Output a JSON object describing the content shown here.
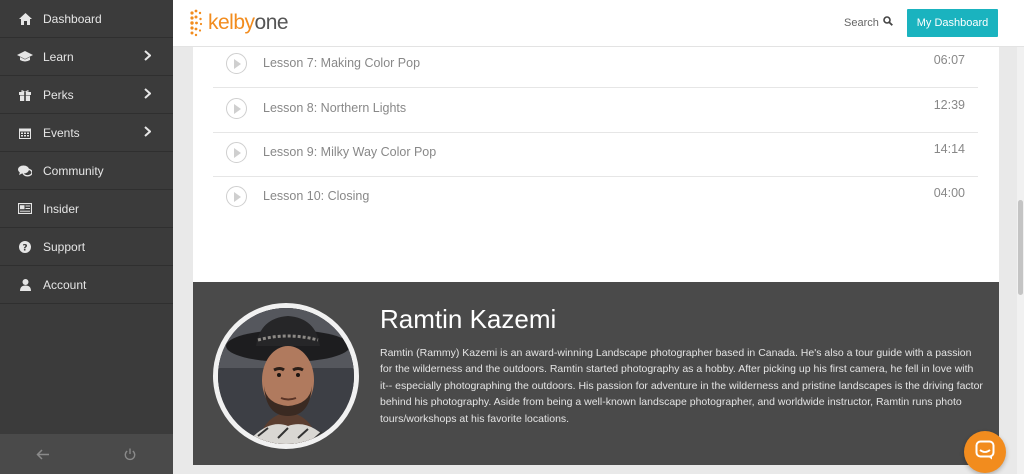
{
  "sidebar": {
    "items": [
      {
        "label": "Dashboard",
        "icon": "home-icon",
        "has_submenu": false
      },
      {
        "label": "Learn",
        "icon": "graduation-cap-icon",
        "has_submenu": true
      },
      {
        "label": "Perks",
        "icon": "gift-icon",
        "has_submenu": true
      },
      {
        "label": "Events",
        "icon": "calendar-icon",
        "has_submenu": true
      },
      {
        "label": "Community",
        "icon": "comments-icon",
        "has_submenu": false
      },
      {
        "label": "Insider",
        "icon": "newspaper-icon",
        "has_submenu": false
      },
      {
        "label": "Support",
        "icon": "question-circle-icon",
        "has_submenu": false
      },
      {
        "label": "Account",
        "icon": "user-icon",
        "has_submenu": false
      }
    ],
    "bottom": {
      "back_icon": "arrow-left-icon",
      "power_icon": "power-icon"
    }
  },
  "header": {
    "logo_kelby": "kelby",
    "logo_one": "one",
    "search_label": "Search",
    "dashboard_button": "My Dashboard"
  },
  "lessons": [
    {
      "title": "Lesson 7: Making Color Pop",
      "duration": "06:07"
    },
    {
      "title": "Lesson 8: Northern Lights",
      "duration": "12:39"
    },
    {
      "title": "Lesson 9: Milky Way Color Pop",
      "duration": "14:14"
    },
    {
      "title": "Lesson 10: Closing",
      "duration": "04:00"
    }
  ],
  "instructor": {
    "name": "Ramtin Kazemi",
    "bio": "Ramtin (Rammy) Kazemi is an award-winning Landscape photographer based in Canada. He's also a tour guide with a passion for the wilderness and the outdoors. Ramtin started photography as a hobby. After picking up his first camera, he fell in love with it-- especially photographing the outdoors. His passion for adventure in the wilderness and pristine landscapes is the driving factor behind his photography. Aside from being a well-known landscape photographer, and worldwide instructor, Ramtin runs photo tours/workshops at his favorite locations."
  },
  "colors": {
    "accent": "#1ab3bf",
    "brand_orange": "#f28c1e",
    "sidebar_bg": "#3b3b3b",
    "instructor_bg": "#4a4a4a"
  }
}
